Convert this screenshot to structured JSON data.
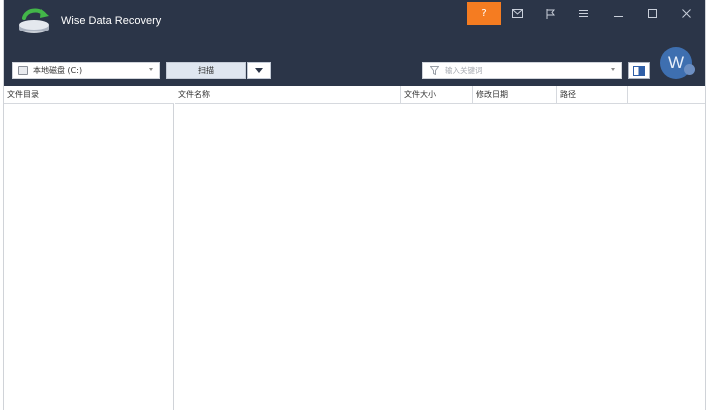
{
  "app": {
    "title": "Wise Data Recovery"
  },
  "toolbar": {
    "help_label": "?",
    "icons": [
      "help-icon",
      "mail-icon",
      "flag-icon",
      "menu-icon",
      "minimize-icon",
      "maximize-icon",
      "close-icon"
    ]
  },
  "controls": {
    "drive_selected": "本地磁盘 (C:)",
    "scan_label": "扫描",
    "filter_placeholder": "输入关键词"
  },
  "user": {
    "avatar_letter": "W"
  },
  "colors": {
    "header_bg": "#2b3548",
    "accent": "#f57c21",
    "avatar": "#3e6fb0"
  },
  "left_pane": {
    "header": "文件目录"
  },
  "file_list": {
    "columns": [
      "文件名称",
      "文件大小",
      "修改日期",
      "路径"
    ],
    "rows": []
  }
}
